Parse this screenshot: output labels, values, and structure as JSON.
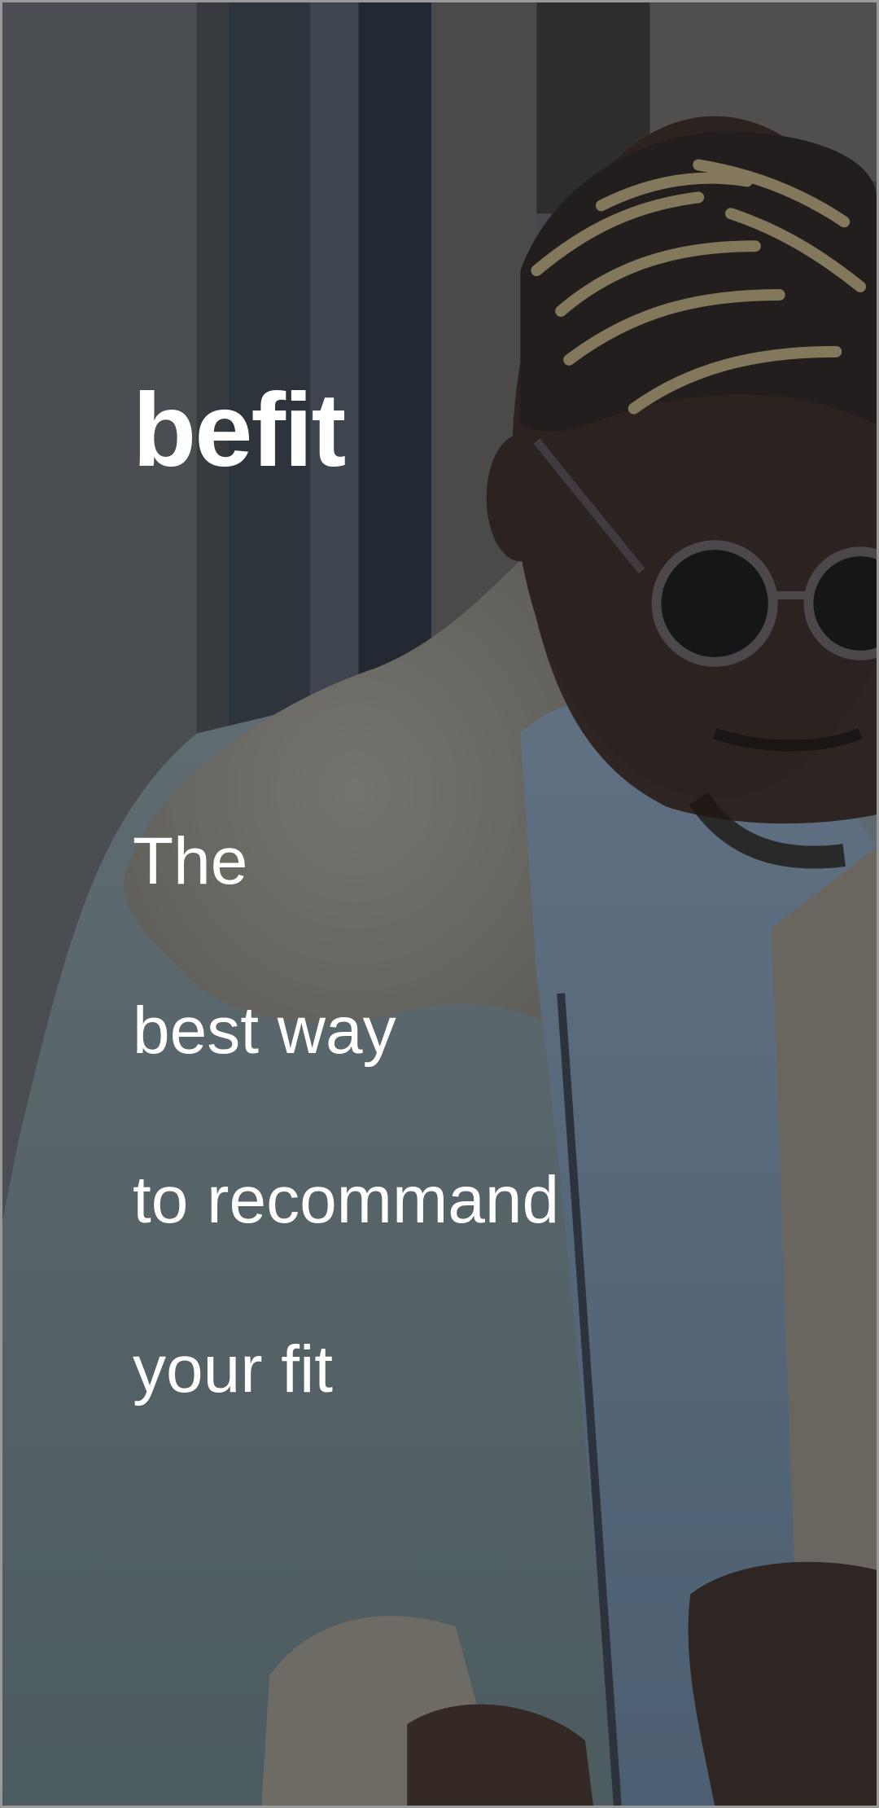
{
  "app": {
    "brand": "befit"
  },
  "tagline": {
    "line1": "The",
    "line2": "best way",
    "line3": "to recommand",
    "line4": "your fit"
  },
  "background": {
    "subject": "man in sunglasses and shearling jacket",
    "overlay_color": "#14181e"
  }
}
